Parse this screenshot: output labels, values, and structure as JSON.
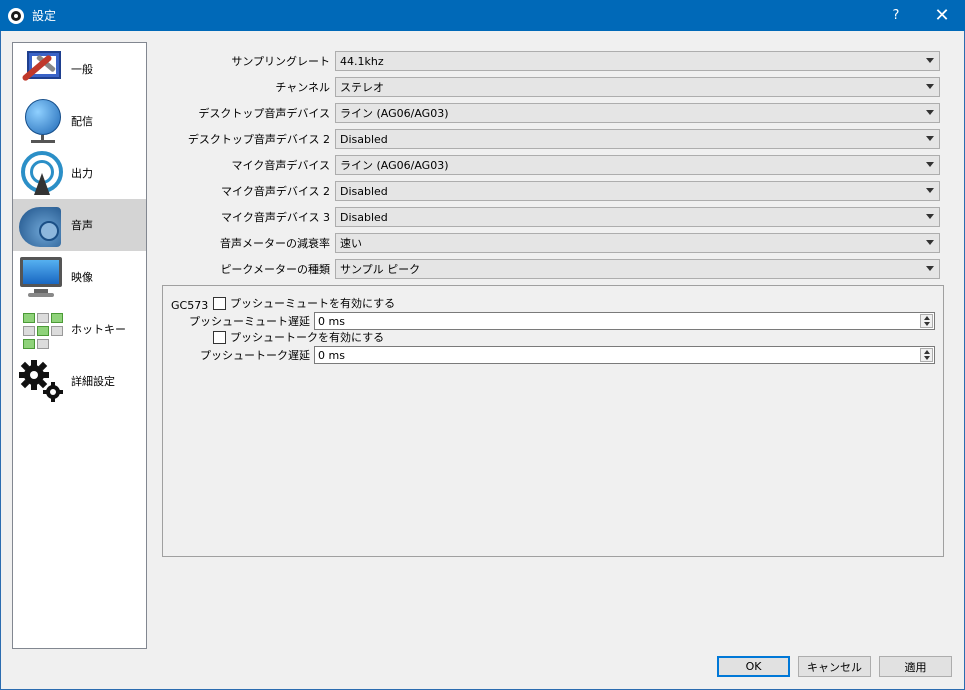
{
  "window": {
    "title": "設定",
    "help_label": "?",
    "close_label": "✕"
  },
  "sidebar": {
    "items": [
      {
        "label": "一般",
        "icon": "general-tools-icon"
      },
      {
        "label": "配信",
        "icon": "globe-icon"
      },
      {
        "label": "出力",
        "icon": "broadcast-tower-icon"
      },
      {
        "label": "音声",
        "icon": "speaker-icon"
      },
      {
        "label": "映像",
        "icon": "monitor-icon"
      },
      {
        "label": "ホットキー",
        "icon": "keyboard-icon"
      },
      {
        "label": "詳細設定",
        "icon": "gears-icon"
      }
    ],
    "selected": "音声"
  },
  "audio": {
    "rows": [
      {
        "label": "サンプリングレート",
        "value": "44.1khz"
      },
      {
        "label": "チャンネル",
        "value": "ステレオ"
      },
      {
        "label": "デスクトップ音声デバイス",
        "value": "ライン (AG06/AG03)"
      },
      {
        "label": "デスクトップ音声デバイス 2",
        "value": "Disabled"
      },
      {
        "label": "マイク音声デバイス",
        "value": "ライン (AG06/AG03)"
      },
      {
        "label": "マイク音声デバイス 2",
        "value": "Disabled"
      },
      {
        "label": "マイク音声デバイス 3",
        "value": "Disabled"
      },
      {
        "label": "音声メーターの減衰率",
        "value": "速い"
      },
      {
        "label": "ピークメーターの種類",
        "value": "サンプル ピーク"
      }
    ]
  },
  "device_group": {
    "title": "GC573",
    "push_to_mute_check": "プッシューミュートを有効にする",
    "push_to_mute_delay_label": "プッシューミュート遅延",
    "push_to_mute_delay_value": "0 ms",
    "push_to_talk_check": "プッシュートークを有効にする",
    "push_to_talk_delay_label": "プッシュートーク遅延",
    "push_to_talk_delay_value": "0 ms"
  },
  "footer": {
    "ok": "OK",
    "cancel": "キャンセル",
    "apply": "適用"
  }
}
